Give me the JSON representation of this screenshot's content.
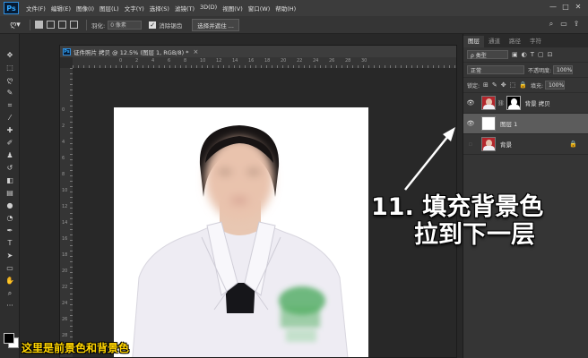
{
  "app": {
    "logo": "Ps"
  },
  "menu": [
    "文件(F)",
    "编辑(E)",
    "图像(I)",
    "图层(L)",
    "文字(Y)",
    "选择(S)",
    "滤镜(T)",
    "3D(D)",
    "视图(V)",
    "窗口(W)",
    "帮助(H)"
  ],
  "window_controls": [
    "—",
    "□",
    "✕"
  ],
  "options": {
    "feather_label": "羽化:",
    "feather_value": "0 像素",
    "antialias_label": "消除锯齿",
    "select_mask_button": "选择并遮住 ..."
  },
  "document": {
    "tab_title": "证件照片 拷贝 @ 12.5% (图层 1, RGB/8) *",
    "close_glyph": "×",
    "ruler_h": [
      "0",
      "2",
      "4",
      "6",
      "8",
      "10",
      "12",
      "14",
      "16",
      "18",
      "20",
      "22",
      "24",
      "26",
      "28",
      "30"
    ],
    "ruler_v": [
      "0",
      "2",
      "4",
      "6",
      "8",
      "10",
      "12",
      "14",
      "16",
      "18",
      "20",
      "22",
      "24",
      "26",
      "28",
      "30",
      "32"
    ]
  },
  "panels": {
    "tabs": [
      "图层",
      "通道",
      "路径",
      "字符"
    ],
    "kind_filter": "ρ 类型",
    "blend_mode": "正常",
    "opacity_label": "不透明度:",
    "opacity_value": "100%",
    "lock_label": "锁定:",
    "fill_label": "填充:",
    "fill_value": "100%",
    "layers": [
      {
        "name": "背景 拷贝",
        "visible": true,
        "selected": false,
        "has_mask": true
      },
      {
        "name": "图层 1",
        "visible": true,
        "selected": true,
        "has_mask": false
      },
      {
        "name": "背景",
        "visible": false,
        "selected": false,
        "locked": true
      }
    ]
  },
  "annotation": {
    "line1": "11. 填充背景色",
    "line2": "拉到下一层"
  },
  "caption": "这里是前景色和背景色",
  "colors": {
    "foreground": "#000000",
    "background": "#ffffff",
    "annotation": "#ffffff",
    "caption": "#ffd400",
    "photo_bg": "#ffffff",
    "layer1_fill": "#ffffff"
  },
  "icons": {
    "tools": [
      "move-icon",
      "marquee-icon",
      "lasso-icon",
      "quick-select-icon",
      "crop-icon",
      "eyedropper-icon",
      "healing-icon",
      "brush-icon",
      "stamp-icon",
      "history-brush-icon",
      "eraser-icon",
      "gradient-icon",
      "blur-icon",
      "dodge-icon",
      "pen-icon",
      "type-icon",
      "path-select-icon",
      "shape-icon",
      "hand-icon",
      "zoom-icon",
      "more-icon"
    ]
  }
}
